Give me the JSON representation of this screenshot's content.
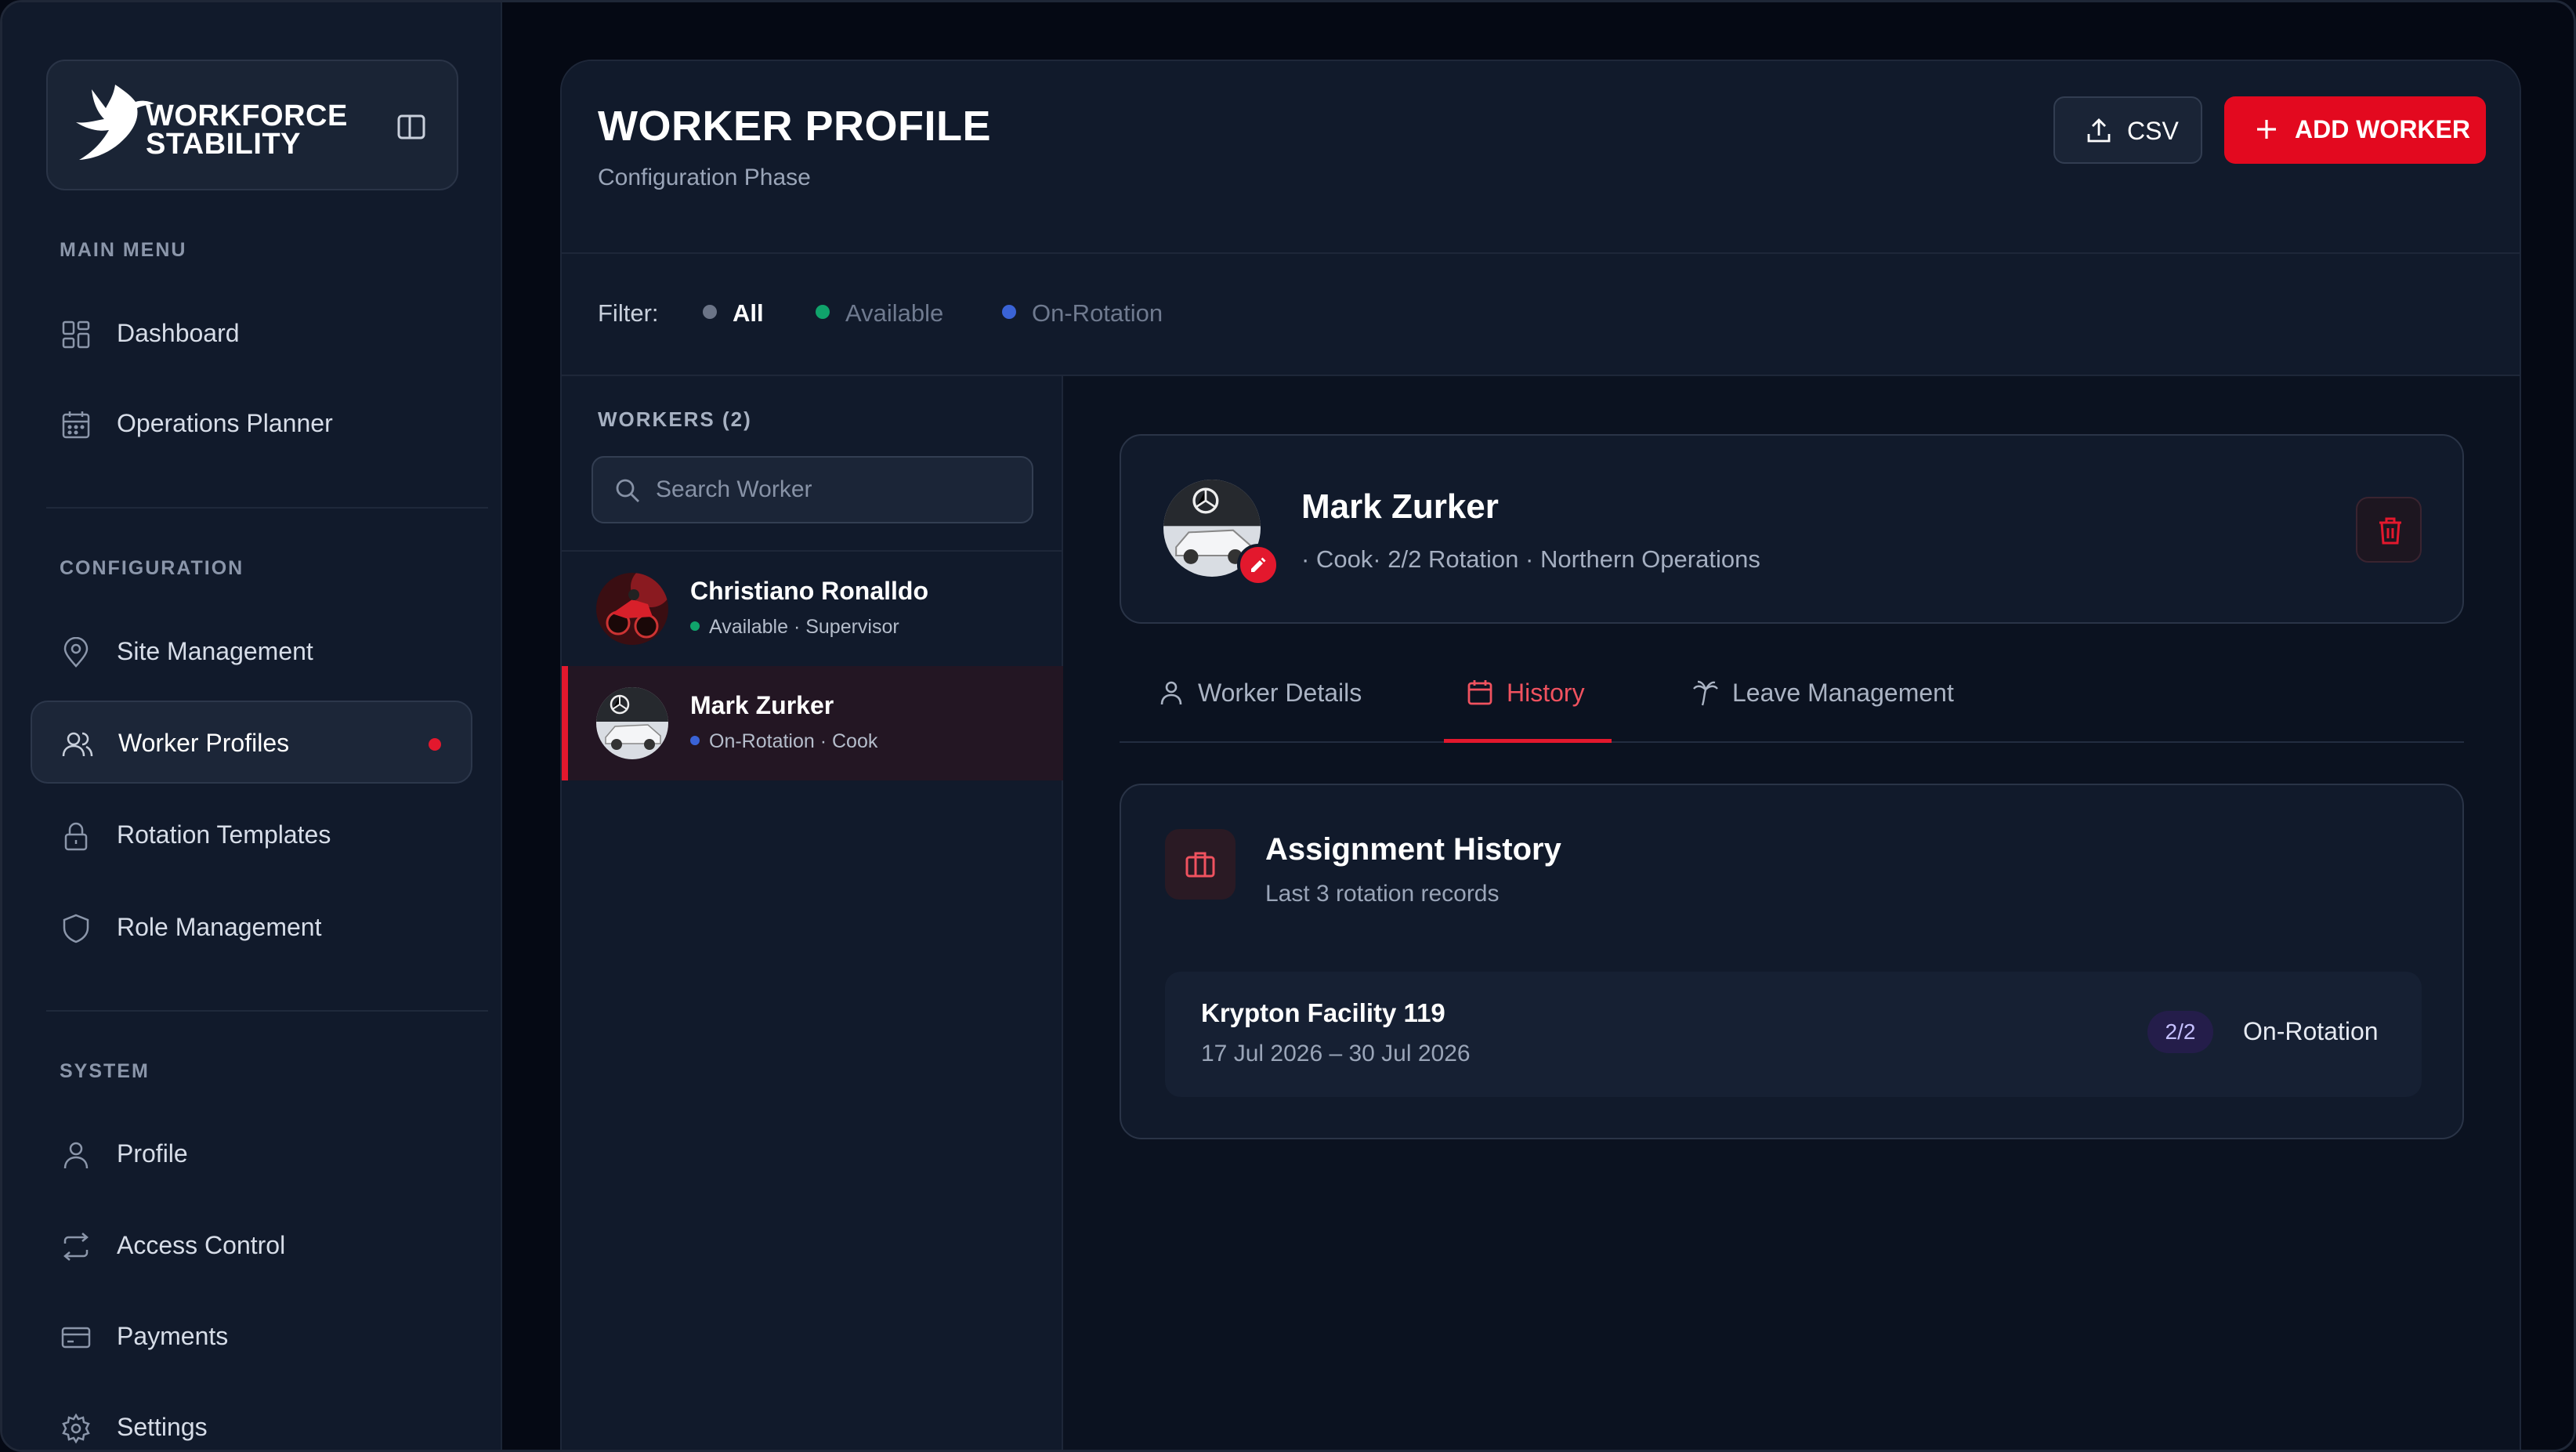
{
  "brand": {
    "line1": "WORKFORCE",
    "line2": "STABILITY"
  },
  "sidebar": {
    "sections": [
      {
        "label": "MAIN MENU"
      },
      {
        "label": "CONFIGURATION"
      },
      {
        "label": "SYSTEM"
      }
    ],
    "items": [
      {
        "label": "Dashboard",
        "icon": "dashboard-icon"
      },
      {
        "label": "Operations Planner",
        "icon": "calendar-icon"
      },
      {
        "label": "Site Management",
        "icon": "location-pin-icon"
      },
      {
        "label": "Worker Profiles",
        "icon": "users-icon",
        "active": true
      },
      {
        "label": "Rotation Templates",
        "icon": "lock-icon"
      },
      {
        "label": "Role Management",
        "icon": "shield-icon"
      },
      {
        "label": "Profile",
        "icon": "user-icon"
      },
      {
        "label": "Access Control",
        "icon": "repeat-icon"
      },
      {
        "label": "Payments",
        "icon": "credit-card-icon"
      },
      {
        "label": "Settings",
        "icon": "gear-icon"
      }
    ]
  },
  "header": {
    "title": "WORKER PROFILE",
    "subtitle": "Configuration Phase",
    "csv_label": "CSV",
    "add_label": "ADD WORKER"
  },
  "filter": {
    "label": "Filter:",
    "options": [
      {
        "label": "All",
        "color": "#6b7487",
        "active": true
      },
      {
        "label": "Available",
        "color": "#10a36b"
      },
      {
        "label": "On-Rotation",
        "color": "#3a63d6"
      }
    ]
  },
  "workers": {
    "title": "WORKERS (2)",
    "search_placeholder": "Search Worker",
    "list": [
      {
        "name": "Christiano Ronalldo",
        "meta": "Available · Supervisor",
        "status_color": "#10a36b"
      },
      {
        "name": "Mark Zurker",
        "meta": "On-Rotation · Cook",
        "status_color": "#3a63d6",
        "selected": true
      }
    ]
  },
  "profile": {
    "name": "Mark Zurker",
    "meta": "· Cook· 2/2 Rotation · Northern Operations"
  },
  "tabs": [
    {
      "label": "Worker Details",
      "icon": "user-icon"
    },
    {
      "label": "History",
      "icon": "calendar-icon",
      "active": true
    },
    {
      "label": "Leave Management",
      "icon": "palm-tree-icon"
    }
  ],
  "history": {
    "title": "Assignment History",
    "subtitle": "Last 3 rotation records",
    "records": [
      {
        "site": "Krypton Facility 119",
        "dates": "17 Jul 2026 – 30 Jul 2026",
        "rotation": "2/2",
        "status": "On-Rotation"
      }
    ]
  },
  "colors": {
    "accent": "#e3182d",
    "background": "#050914",
    "panel": "#111a2b"
  }
}
